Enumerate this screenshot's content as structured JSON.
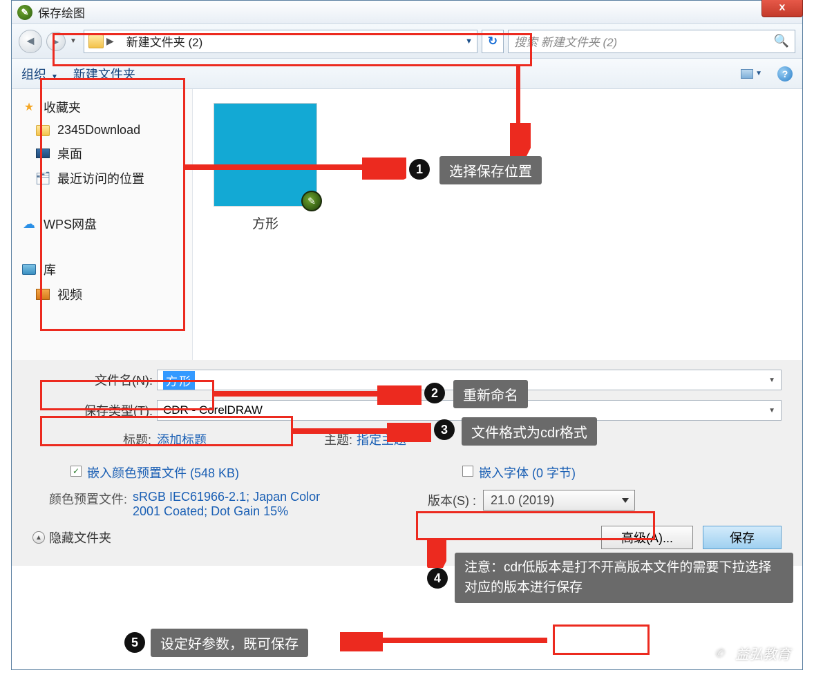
{
  "window": {
    "title": "保存绘图",
    "close_label": "x"
  },
  "nav": {
    "breadcrumb_root_sep": "▶",
    "breadcrumb_item": "新建文件夹 (2)",
    "refresh_glyph": "↻",
    "search_placeholder": "搜索 新建文件夹 (2)"
  },
  "toolbar": {
    "organize": "组织",
    "new_folder": "新建文件夹",
    "help_glyph": "?"
  },
  "sidebar": {
    "favorites": "收藏夹",
    "download": "2345Download",
    "desktop": "桌面",
    "recent": "最近访问的位置",
    "wps": "WPS网盘",
    "lib": "库",
    "video": "视频"
  },
  "file": {
    "name": "方形"
  },
  "form": {
    "filename_label": "文件名(N):",
    "filename_value": "方形",
    "type_label": "保存类型(T):",
    "type_value": "CDR - CorelDRAW",
    "title_label": "标题:",
    "title_value": "添加标题",
    "subject_label": "主题:",
    "subject_value": "指定主题",
    "embed_profile": "嵌入颜色预置文件 (548 KB)",
    "embed_font": "嵌入字体 (0 字节)",
    "profile_label": "颜色预置文件:",
    "profile_value": "sRGB IEC61966-2.1; Japan Color 2001 Coated; Dot Gain 15%",
    "version_label": "版本(S) :",
    "version_value": "21.0 (2019)"
  },
  "buttons": {
    "hide": "隐藏文件夹",
    "advanced": "高级(A)...",
    "save": "保存"
  },
  "annotations": {
    "n1": "选择保存位置",
    "n2": "重新命名",
    "n3": "文件格式为cdr格式",
    "n4": "注意：cdr低版本是打不开高版本文件的需要下拉选择对应的版本进行保存",
    "n5": "设定好参数，既可保存"
  },
  "watermark": "益弘教育"
}
